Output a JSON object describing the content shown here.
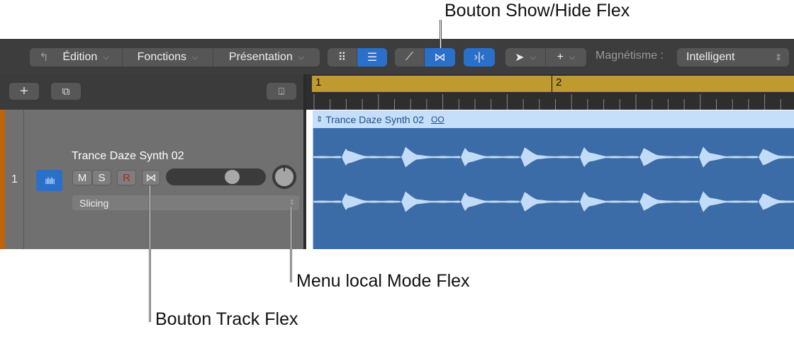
{
  "callouts": {
    "show_hide_flex": "Bouton Show/Hide Flex",
    "flex_mode_menu": "Menu local Mode Flex",
    "track_flex": "Bouton Track Flex"
  },
  "toolbar": {
    "edit": "Édition",
    "functions": "Fonctions",
    "view": "Présentation",
    "snap_label": "Magnétisme :",
    "snap_value": "Intelligent"
  },
  "ruler": {
    "bar1": "1",
    "bar2": "2"
  },
  "track": {
    "number": "1",
    "name": "Trance Daze Synth 02",
    "mute": "M",
    "solo": "S",
    "record": "R",
    "flex_mode": "Slicing",
    "volume": 0.7
  },
  "region": {
    "name": "Trance Daze Synth 02",
    "loop_glyph": "OO"
  },
  "colors": {
    "accent": "#2a6fc9",
    "bar_ruler": "#bf9a2e",
    "track_stripe": "#c0630a",
    "region": "#3b6ca8"
  }
}
